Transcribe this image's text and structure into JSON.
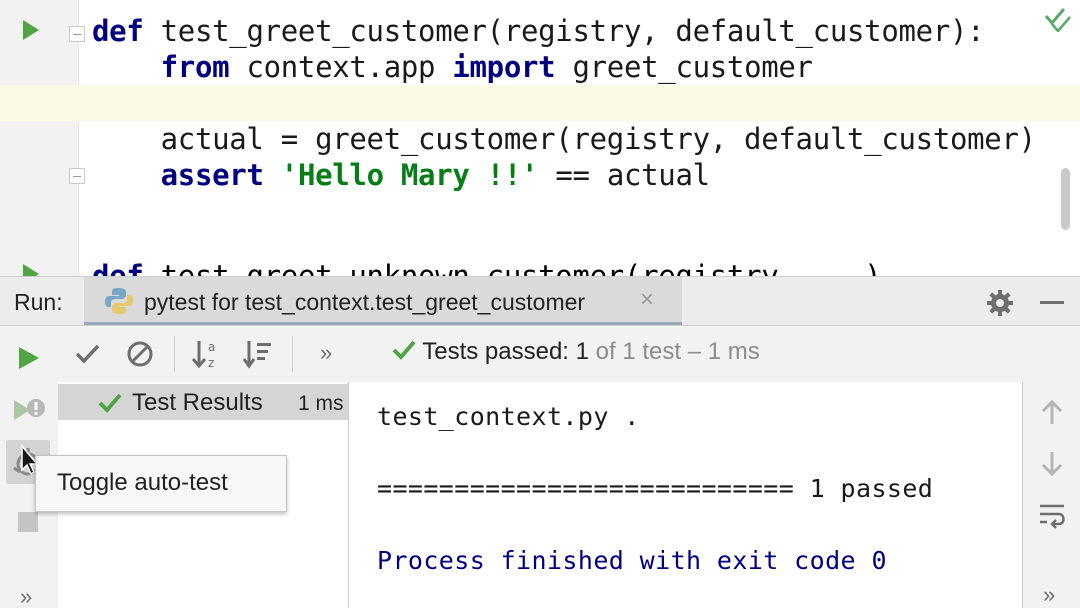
{
  "editor": {
    "lines": [
      {
        "parts": [
          {
            "t": "def",
            "c": "kw"
          },
          {
            "t": " test_greet_customer(registry, default_customer):",
            "c": ""
          }
        ]
      },
      {
        "parts": [
          {
            "t": "    ",
            "c": ""
          },
          {
            "t": "from",
            "c": "kw"
          },
          {
            "t": " context.app ",
            "c": ""
          },
          {
            "t": "import",
            "c": "kw"
          },
          {
            "t": " greet_customer",
            "c": ""
          }
        ]
      },
      {
        "parts": [
          {
            "t": "",
            "c": ""
          }
        ]
      },
      {
        "parts": [
          {
            "t": "    actual = greet_customer(registry, default_customer)",
            "c": ""
          }
        ]
      },
      {
        "parts": [
          {
            "t": "    ",
            "c": ""
          },
          {
            "t": "assert",
            "c": "kw"
          },
          {
            "t": " ",
            "c": ""
          },
          {
            "t": "'Hello Mary !!'",
            "c": "str"
          },
          {
            "t": " == actual",
            "c": ""
          }
        ]
      }
    ]
  },
  "run_panel": {
    "label": "Run:",
    "tab_title": "pytest for test_context.test_greet_customer",
    "tab_close": "×",
    "status_prefix": "Tests passed: 1",
    "status_suffix": " of 1 test – 1 ms",
    "tree_root_label": "Test Results",
    "tree_root_time": "1 ms",
    "console_lines": [
      {
        "text": "test_context.py .",
        "style": "normal"
      },
      {
        "text": "",
        "style": "normal"
      },
      {
        "text": "=========================== 1 passed",
        "style": "normal"
      },
      {
        "text": "",
        "style": "normal"
      },
      {
        "text": "Process finished with exit code 0",
        "style": "blue"
      }
    ],
    "tooltip": "Toggle auto-test"
  },
  "colors": {
    "run_green": "#4fa542",
    "pass_green": "#59a869",
    "keyword_navy": "#000080",
    "string_teal": "#067d17"
  }
}
